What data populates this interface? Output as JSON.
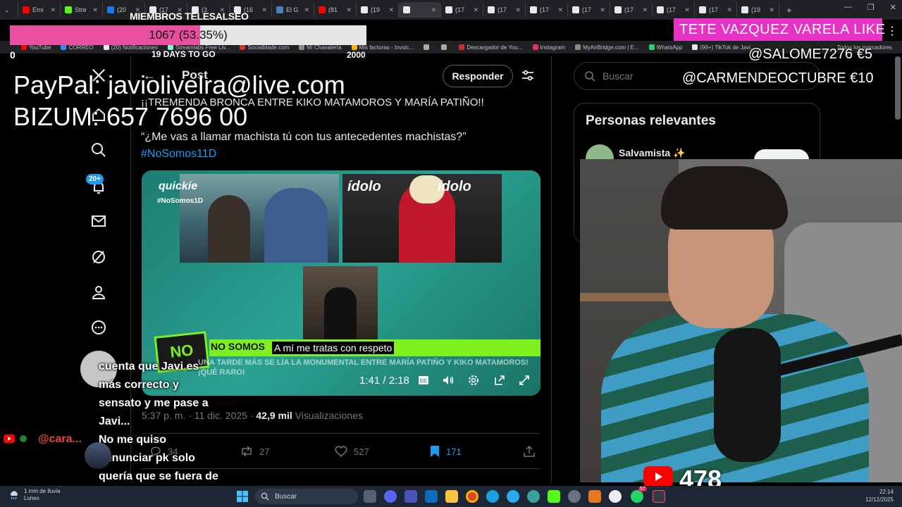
{
  "browser": {
    "tabs": [
      {
        "label": "Emi",
        "fav": "#ff0000"
      },
      {
        "label": "Stre",
        "fav": "#53fc18"
      },
      {
        "label": "(20",
        "fav": "#1877f2"
      },
      {
        "label": "(17",
        "fav": "#e7e9ea"
      },
      {
        "label": "(3",
        "fav": "#e7e9ea"
      },
      {
        "label": "(16",
        "fav": "#e7e9ea"
      },
      {
        "label": "El G",
        "fav": "#4a7fc1"
      },
      {
        "label": "(81",
        "fav": "#ff0000"
      },
      {
        "label": "(19",
        "fav": "#e7e9ea"
      },
      {
        "label": "",
        "fav": "#e7e9ea"
      },
      {
        "label": "(17",
        "fav": "#e7e9ea"
      },
      {
        "label": "(17",
        "fav": "#e7e9ea"
      },
      {
        "label": "(17",
        "fav": "#e7e9ea"
      },
      {
        "label": "(17",
        "fav": "#e7e9ea"
      },
      {
        "label": "(17",
        "fav": "#e7e9ea"
      },
      {
        "label": "(17",
        "fav": "#e7e9ea"
      },
      {
        "label": "(17",
        "fav": "#e7e9ea"
      },
      {
        "label": "(19",
        "fav": "#e7e9ea"
      }
    ],
    "new_tab": "+",
    "bookmarks": [
      {
        "label": "YouTube",
        "fav": "#ff0000"
      },
      {
        "label": "CORREO",
        "fav": "#4285f4"
      },
      {
        "label": "(20) Notificaciones",
        "fav": "#e7e9ea"
      },
      {
        "label": "Streamlabs Free Liv...",
        "fav": "#80f5d2"
      },
      {
        "label": "Socialblade.com",
        "fav": "#c0392b"
      },
      {
        "label": "Mi Chavalería",
        "fav": "#888888"
      },
      {
        "label": "Mis facturas - Invoic...",
        "fav": "#f4b400"
      },
      {
        "label": "",
        "fav": "#aaaaaa"
      },
      {
        "label": "",
        "fav": "#aaaaaa"
      },
      {
        "label": "Descargador de You...",
        "fav": "#c4302b"
      },
      {
        "label": "Instagram",
        "fav": "#e1306c"
      },
      {
        "label": "MyAirBridge.com | E...",
        "fav": "#888888"
      },
      {
        "label": "WhatsApp",
        "fav": "#25d366"
      },
      {
        "label": "(99+) TikTok de Javi...",
        "fav": "#e7e9ea"
      }
    ],
    "all_bookmarks": "Todos los marcadores"
  },
  "overlay": {
    "members_title": "MIEMBROS TELESALSEO",
    "progress_label": "1067 (53.35%)",
    "progress_fraction": 0.5335,
    "progress_min": "0",
    "progress_days": "19 DAYS TO GO",
    "progress_max": "2000",
    "paypal": "PayPal: javiolivelra@live.com",
    "bizum": "BIZUM: 657 7696 00",
    "like_banner": "TETE VAZQUEZ VARELA  LIKE",
    "donor1": "@SALOME7276  €5",
    "donor2": "@CARMENDEOCTUBRE  €10",
    "chat_user": "@cara...",
    "chat_text": "cuenta que Javi es\nmás correcto y\nsensato y me pase a\nJavi...\nNo me quiso\ndenunciar pk solo\nquería que se fuera de\ncasa",
    "viewer_count": "478"
  },
  "twitter": {
    "nav_badge": "20+",
    "post_heading": "Post",
    "reply_button": "Responder",
    "tweet_line1": "¡¡TREMENDA BRONCA ENTRE KIKO MATAMOROS Y MARÍA PATIÑO!!",
    "tweet_line2": "“¿Me vas a llamar machista tú con tus antecedentes machistas?”",
    "hashtag": "#NoSomos11D",
    "video": {
      "brand": "quickie",
      "brand_tag": "#NoSomos1D",
      "idolo": "ídolo",
      "news_bar_label": "NO SOMOS",
      "ticker": "UNA TARDE MÁS SE LÍA LA MONUMENTAL ENTRE MARÍA PATIÑO Y KIKO MATAMOROS! ¡QUÉ RARO!",
      "logo": "NO",
      "subtitle": "A mí me tratas con respeto",
      "time": "1:41 / 2:18"
    },
    "meta_time": "5:37 p. m. · 11 dic. 2025 · ",
    "meta_views_count": "42,9 mil",
    "meta_views_label": " Visualizaciones",
    "stats": {
      "replies": "34",
      "reposts": "27",
      "likes": "527",
      "bookmarks": "171"
    },
    "search_placeholder": "Buscar",
    "relevant_title": "Personas relevantes",
    "relevant_name": "Salvamista ✨"
  },
  "taskbar": {
    "weather": "1 mm de lluvia",
    "weather_day": "Lunes",
    "search": "Buscar",
    "time": "22:14",
    "date": "12/12/2025",
    "notif_count": "57"
  }
}
